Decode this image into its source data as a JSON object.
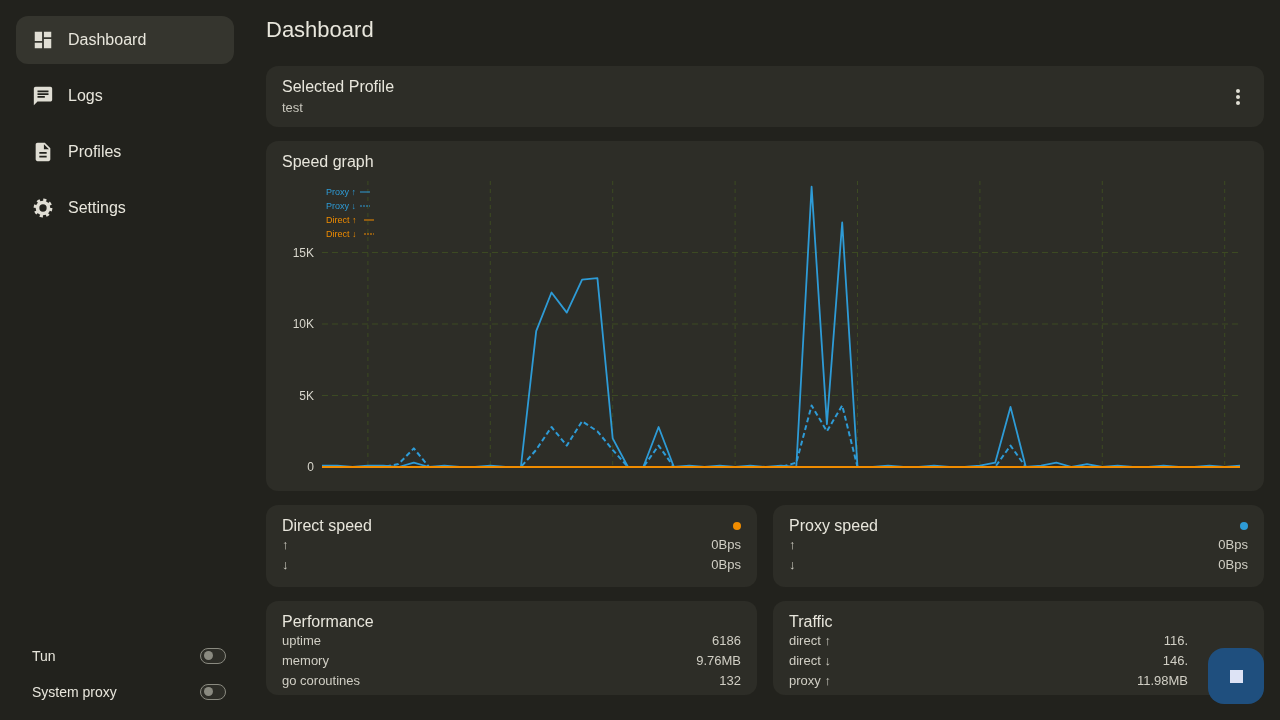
{
  "sidebar": {
    "items": [
      {
        "label": "Dashboard",
        "selected": true
      },
      {
        "label": "Logs",
        "selected": false
      },
      {
        "label": "Profiles",
        "selected": false
      },
      {
        "label": "Settings",
        "selected": false
      }
    ],
    "toggles": [
      {
        "label": "Tun",
        "on": false
      },
      {
        "label": "System proxy",
        "on": false
      }
    ]
  },
  "page_title": "Dashboard",
  "selected_profile": {
    "title": "Selected Profile",
    "value": "test"
  },
  "speed_graph": {
    "title": "Speed graph",
    "chart_data": {
      "type": "line",
      "grid": true,
      "legend": true,
      "ylim": [
        0,
        20000
      ],
      "yticks": [
        {
          "value": 0,
          "label": "0"
        },
        {
          "value": 5000,
          "label": "5K"
        },
        {
          "value": 10000,
          "label": "10K"
        },
        {
          "value": 15000,
          "label": "15K"
        }
      ],
      "series": [
        {
          "name": "Proxy ↑",
          "color": "#2e9bd6",
          "line_style": "solid",
          "values": [
            100,
            100,
            0,
            100,
            100,
            0,
            300,
            0,
            100,
            0,
            0,
            100,
            0,
            0,
            9500,
            12200,
            10800,
            13100,
            13200,
            2000,
            0,
            0,
            2800,
            0,
            100,
            0,
            100,
            0,
            100,
            0,
            100,
            0,
            19600,
            3000,
            17100,
            0,
            0,
            100,
            0,
            0,
            100,
            0,
            0,
            100,
            300,
            4200,
            0,
            100,
            300,
            0,
            200,
            0,
            100,
            0,
            0,
            100,
            0,
            0,
            100,
            0,
            100
          ]
        },
        {
          "name": "Proxy ↓",
          "color": "#2e9bd6",
          "line_style": "dashed",
          "values": [
            0,
            0,
            0,
            0,
            0,
            200,
            1300,
            0,
            0,
            0,
            0,
            0,
            0,
            0,
            1200,
            2800,
            1500,
            3200,
            2500,
            1200,
            0,
            0,
            1500,
            0,
            0,
            0,
            0,
            0,
            0,
            0,
            0,
            300,
            4300,
            2500,
            4300,
            0,
            0,
            0,
            0,
            0,
            0,
            0,
            0,
            0,
            0,
            1500,
            0,
            0,
            0,
            0,
            0,
            0,
            0,
            0,
            0,
            0,
            0,
            0,
            0,
            0,
            0
          ]
        },
        {
          "name": "Direct ↑",
          "color": "#f08c00",
          "line_style": "solid",
          "values": [
            0,
            0,
            0,
            0,
            0,
            0,
            0,
            0,
            0,
            0,
            0,
            0,
            0,
            0,
            0,
            0,
            0,
            0,
            0,
            0,
            0,
            0,
            0,
            0,
            0,
            0,
            0,
            0,
            0,
            0,
            0,
            0,
            0,
            0,
            0,
            0,
            0,
            0,
            0,
            0,
            0,
            0,
            0,
            0,
            0,
            0,
            0,
            0,
            0,
            0,
            0,
            0,
            0,
            0,
            0,
            0,
            0,
            0,
            0,
            0,
            0
          ]
        },
        {
          "name": "Direct ↓",
          "color": "#f08c00",
          "line_style": "dashed",
          "values": [
            0,
            0,
            0,
            0,
            0,
            0,
            0,
            0,
            0,
            0,
            0,
            0,
            0,
            0,
            0,
            0,
            0,
            0,
            0,
            0,
            0,
            0,
            0,
            0,
            0,
            0,
            0,
            0,
            0,
            0,
            0,
            0,
            0,
            0,
            0,
            0,
            0,
            0,
            0,
            0,
            0,
            0,
            0,
            0,
            0,
            0,
            0,
            0,
            0,
            0,
            0,
            0,
            0,
            0,
            0,
            0,
            0,
            0,
            0,
            0,
            0
          ]
        }
      ]
    }
  },
  "speed_cards": [
    {
      "title": "Direct speed",
      "color": "#f08c00",
      "rows": [
        {
          "label": "↑",
          "value": "0Bps"
        },
        {
          "label": "↓",
          "value": "0Bps"
        }
      ]
    },
    {
      "title": "Proxy speed",
      "color": "#2e9bd6",
      "rows": [
        {
          "label": "↑",
          "value": "0Bps"
        },
        {
          "label": "↓",
          "value": "0Bps"
        }
      ]
    }
  ],
  "stat_cards": [
    {
      "title": "Performance",
      "rows": [
        {
          "label": "uptime",
          "value": "6186"
        },
        {
          "label": "memory",
          "value": "9.76MB"
        },
        {
          "label": "go coroutines",
          "value": "132"
        }
      ]
    },
    {
      "title": "Traffic",
      "rows": [
        {
          "label": "direct ↑",
          "value": "116."
        },
        {
          "label": "direct ↓",
          "value": "146."
        },
        {
          "label": "proxy ↑",
          "value": "11.98MB"
        }
      ]
    }
  ],
  "fab": {
    "kind": "stop"
  }
}
